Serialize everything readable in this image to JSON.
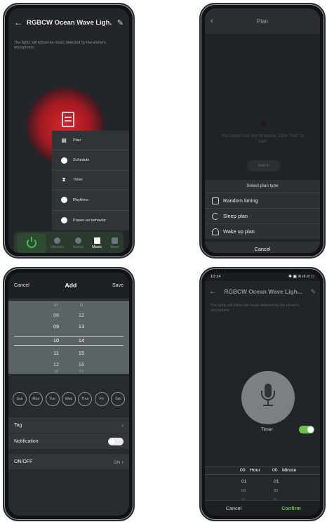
{
  "phone1": {
    "title": "RGBCW Ocean Wave Ligh...",
    "hint": "The lights will follow the music detected by the phone's microphone.",
    "menu": [
      {
        "label": "Plan",
        "icon": "plan-icon"
      },
      {
        "label": "Schedule",
        "icon": "clock-icon"
      },
      {
        "label": "Timer",
        "icon": "hourglass-icon"
      },
      {
        "label": "Rhythms",
        "icon": "rhythm-icon"
      },
      {
        "label": "Power-on behavior",
        "icon": "power-behavior-icon"
      }
    ],
    "tabs": [
      {
        "label": "Dimmer"
      },
      {
        "label": "Scene"
      },
      {
        "label": "Music"
      },
      {
        "label": "More"
      }
    ],
    "active_tab": "Music",
    "accent": "#36c24a"
  },
  "phone2": {
    "title": "Plan",
    "empty_text": "You haven't set any timetable. Click \"Add\" to start",
    "add_label": "Add to",
    "sheet_title": "Select plan type",
    "options": [
      {
        "label": "Random timing",
        "icon": "random-timing-icon"
      },
      {
        "label": "Sleep plan",
        "icon": "moon-icon"
      },
      {
        "label": "Wake up plan",
        "icon": "bell-icon"
      }
    ],
    "cancel_label": "Cancel"
  },
  "phone3": {
    "cancel_label": "Cancel",
    "title": "Add",
    "save_label": "Save",
    "picker_hours": [
      "07",
      "08",
      "09",
      "10",
      "11",
      "12",
      "13"
    ],
    "picker_minutes": [
      "11",
      "12",
      "13",
      "14",
      "15",
      "16",
      "17"
    ],
    "days": [
      "Sun",
      "Mon",
      "Tue",
      "Wed",
      "Thur",
      "Fri",
      "Sat"
    ],
    "tag_label": "Tag",
    "notification_label": "Notification",
    "onoff_label": "ON/OFF",
    "onoff_value": "ON"
  },
  "phone4": {
    "status_time": "10:14",
    "status_icons": "✱ ▣ ≋ ıll ıll ▭",
    "title": "RGBCW Ocean Wave Ligh...",
    "hint": "The lights will follow the music detected by the phone's microphone.",
    "timer_label": "Timer",
    "hour_label": "Hour",
    "minute_label": "Minute",
    "hours": [
      "00",
      "01",
      "02",
      "03"
    ],
    "minutes": [
      "00",
      "01",
      "02",
      "03"
    ],
    "cancel_label": "Cancel",
    "confirm_label": "Confirm",
    "accent": "#6cc24a"
  }
}
